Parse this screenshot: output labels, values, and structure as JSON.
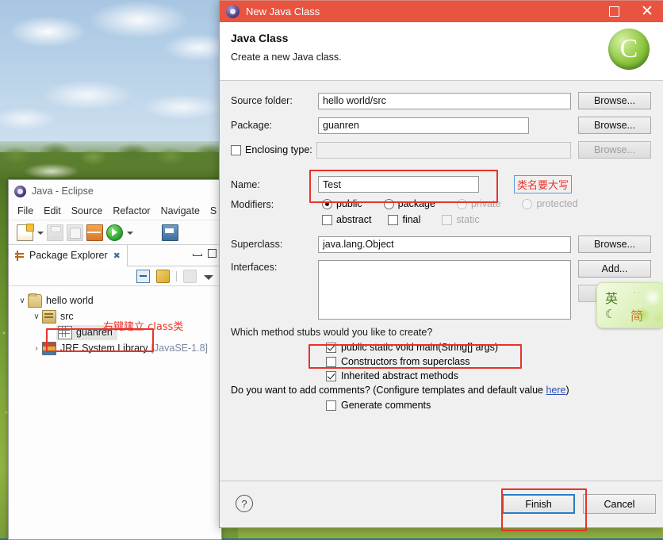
{
  "desktop": {
    "wallpaper_alt": "sky-clouds-trees-meadow"
  },
  "top_fragment": {
    "name": "cut-off-window-fragment"
  },
  "eclipse": {
    "title": "Java - Eclipse",
    "menu": [
      "File",
      "Edit",
      "Source",
      "Refactor",
      "Navigate",
      "S"
    ],
    "toolbar_icons": [
      "new-wizard-icon",
      "dropdown-arrow-icon",
      "save-icon",
      "save-all-icon",
      "new-package-icon",
      "run-icon",
      "run-dropdown-arrow-icon",
      "console-icon"
    ],
    "view": {
      "tab_label": "Package Explorer",
      "tab_close_glyph": "✖",
      "toolbar_icons": [
        "collapse-all-icon",
        "link-with-editor-icon",
        "view-menu-separator",
        "focus-icon",
        "view-menu-icon"
      ],
      "window_buttons": [
        "minimize-icon",
        "maximize-icon"
      ]
    },
    "tree": [
      {
        "indent": 0,
        "twisty": "∨",
        "icon": "project-icon",
        "label": "hello world",
        "dim": ""
      },
      {
        "indent": 1,
        "twisty": "∨",
        "icon": "source-folder-icon",
        "label": "src",
        "dim": ""
      },
      {
        "indent": 2,
        "twisty": "",
        "icon": "package-icon",
        "label": "guanren",
        "dim": ""
      },
      {
        "indent": 1,
        "twisty": "›",
        "icon": "jre-library-icon",
        "label": "JRE System Library",
        "dim": "[JavaSE-1.8]"
      }
    ],
    "annotation": "右键建立 class类"
  },
  "dialog": {
    "titlebar": {
      "icon": "java-wizard-icon",
      "title": "New Java Class",
      "maximize_label": "maximize",
      "close_glyph": "✕"
    },
    "header": {
      "heading": "Java Class",
      "subtitle": "Create a new Java class.",
      "banner_icon": "java-class-banner-icon"
    },
    "fields": [
      {
        "label": "Source folder:",
        "value": "hello world/src",
        "button": "Browse...",
        "enabled": true
      },
      {
        "label": "Package:",
        "value": "guanren",
        "button": "Browse...",
        "enabled": true
      }
    ],
    "enclosing_type": {
      "checkbox_checked": false,
      "label": "Enclosing type:",
      "value": "",
      "button": "Browse...",
      "enabled": false
    },
    "name": {
      "label": "Name:",
      "value": "Test",
      "annotation": "类名要大写"
    },
    "modifiers": {
      "label": "Modifiers:",
      "access": [
        {
          "label": "public",
          "selected": true,
          "enabled": true
        },
        {
          "label": "package",
          "selected": false,
          "enabled": true
        },
        {
          "label": "private",
          "selected": false,
          "enabled": false
        },
        {
          "label": "protected",
          "selected": false,
          "enabled": false
        }
      ],
      "flags": [
        {
          "label": "abstract",
          "checked": false,
          "enabled": true
        },
        {
          "label": "final",
          "checked": false,
          "enabled": true
        },
        {
          "label": "static",
          "checked": false,
          "enabled": false
        }
      ]
    },
    "superclass": {
      "label": "Superclass:",
      "value": "java.lang.Object",
      "button": "Browse..."
    },
    "interfaces": {
      "label": "Interfaces:",
      "value": "",
      "add_button": "Add...",
      "remove_button": "Remove"
    },
    "stubs": {
      "question": "Which method stubs would you like to create?",
      "items": [
        {
          "label": "public static void main(String[] args)",
          "checked": true,
          "highlighted": true
        },
        {
          "label": "Constructors from superclass",
          "checked": false,
          "highlighted": false
        },
        {
          "label": "Inherited abstract methods",
          "checked": true,
          "highlighted": false
        }
      ]
    },
    "comments": {
      "prefix": "Do you want to add comments? (Configure templates and default value ",
      "link": "here",
      "suffix": ")",
      "checkbox": {
        "label": "Generate comments",
        "checked": false
      }
    },
    "footer": {
      "help_glyph": "?",
      "finish_label": "Finish",
      "cancel_label": "Cancel"
    }
  },
  "ime": {
    "name": "input-method-floating-bar",
    "mode_cn": "英",
    "moon_glyph": "☾",
    "simplified_cn": "简",
    "dots": "··"
  },
  "colors": {
    "titlebar": "#e8543f",
    "annotation_red": "#e8332a",
    "primary_button_border": "#2b7cc4",
    "link_blue": "#2a4fb5"
  }
}
